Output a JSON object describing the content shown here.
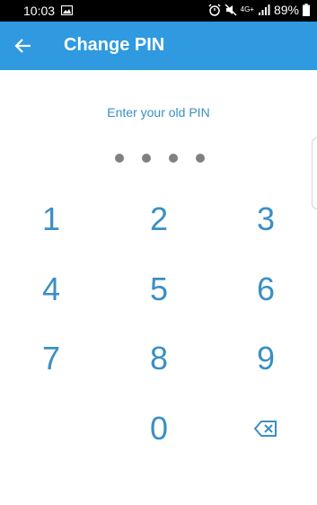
{
  "status_bar": {
    "time": "10:03",
    "network": "4G+",
    "battery_percent": "89%",
    "icons": [
      "gallery-icon",
      "alarm-icon",
      "mute-icon",
      "signal-icon",
      "battery-icon"
    ]
  },
  "app_bar": {
    "title": "Change PIN",
    "back_icon": "back-arrow-icon",
    "color": "#2f9ae0"
  },
  "pin_entry": {
    "prompt": "Enter your old PIN",
    "dot_count": 4
  },
  "keypad": {
    "keys": [
      "1",
      "2",
      "3",
      "4",
      "5",
      "6",
      "7",
      "8",
      "9",
      "0"
    ],
    "backspace_icon": "backspace-icon",
    "accent_color": "#3a8fc3"
  }
}
